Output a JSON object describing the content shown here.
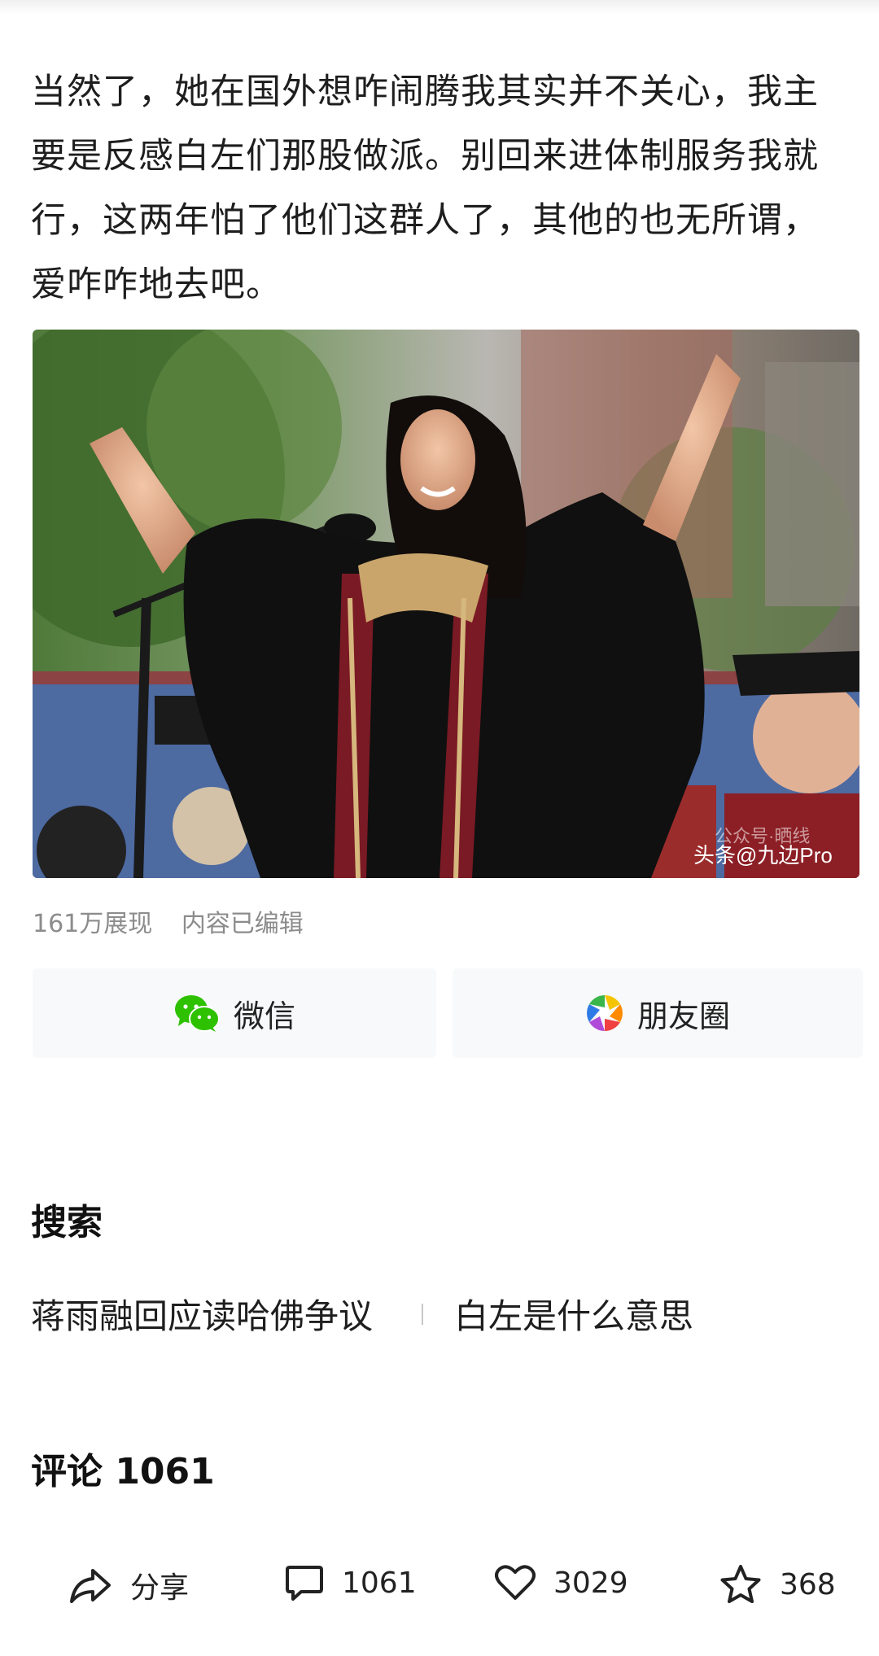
{
  "post": {
    "text": "当然了，她在国外想咋闹腾我其实并不关心，我主要是反感白左们那股做派。别回来进体制服务我就行，这两年怕了他们这群人了，其他的也无所谓，爱咋咋地去吧。",
    "image_watermark": "头条@九边Pro",
    "image_watermark_faint": "公众号·晒线",
    "views": "161万展现",
    "edited": "内容已编辑"
  },
  "share": {
    "wechat_label": "微信",
    "moments_label": "朋友圈"
  },
  "search": {
    "title": "搜索",
    "suggestions": [
      "蒋雨融回应读哈佛争议",
      "白左是什么意思"
    ]
  },
  "comments": {
    "title": "评论 1061"
  },
  "actions": {
    "share_label": "分享",
    "comment_count": "1061",
    "like_count": "3029",
    "favorite_count": "368"
  },
  "colors": {
    "wechat_green": "#2dc100",
    "meta_gray": "#8c8c8c",
    "share_bg": "#f7f9fb"
  }
}
